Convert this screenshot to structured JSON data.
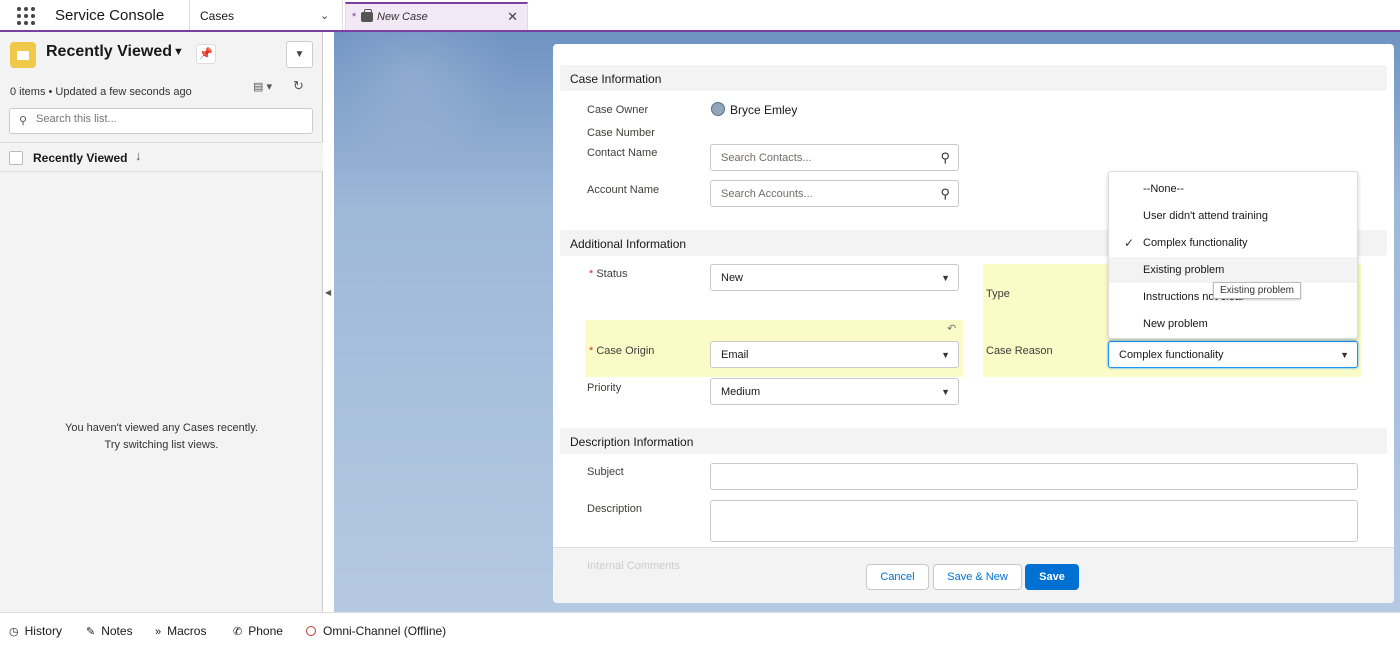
{
  "header": {
    "app_name": "Service Console",
    "nav_item": "Cases",
    "tab": {
      "dirty_marker": "*",
      "label": "New Case",
      "close": "✕"
    }
  },
  "sidebar": {
    "title": "Recently Viewed",
    "meta": "0 items • Updated a few seconds ago",
    "search_placeholder": "Search this list...",
    "column_label": "Recently Viewed",
    "empty_line1": "You haven't viewed any Cases recently.",
    "empty_line2": "Try switching list views."
  },
  "form": {
    "sections": {
      "case_info": "Case Information",
      "additional": "Additional Information",
      "description": "Description Information"
    },
    "case_owner_label": "Case Owner",
    "case_owner_value": "Bryce Emley",
    "case_number_label": "Case Number",
    "contact_label": "Contact Name",
    "contact_placeholder": "Search Contacts...",
    "account_label": "Account Name",
    "account_placeholder": "Search Accounts...",
    "required_marker": "*",
    "status_label": "Status",
    "status_value": "New",
    "type_label": "Type",
    "origin_label": "Case Origin",
    "origin_value": "Email",
    "reason_label": "Case Reason",
    "reason_value": "Complex functionality",
    "priority_label": "Priority",
    "priority_value": "Medium",
    "subject_label": "Subject",
    "description_label": "Description",
    "internal_comments_label": "Internal Comments"
  },
  "reason_options": [
    "--None--",
    "User didn't attend training",
    "Complex functionality",
    "Existing problem",
    "Instructions not clear",
    "New problem"
  ],
  "tooltip": "Existing problem",
  "buttons": {
    "cancel": "Cancel",
    "save_new": "Save & New",
    "save": "Save"
  },
  "utility_bar": {
    "history": "History",
    "notes": "Notes",
    "macros": "Macros",
    "phone": "Phone",
    "omni": "Omni-Channel (Offline)"
  },
  "colors": {
    "accent": "#7b3fa0",
    "brand_blue": "#0070d2",
    "highlight": "#fbfbc8",
    "required": "#c23934"
  }
}
